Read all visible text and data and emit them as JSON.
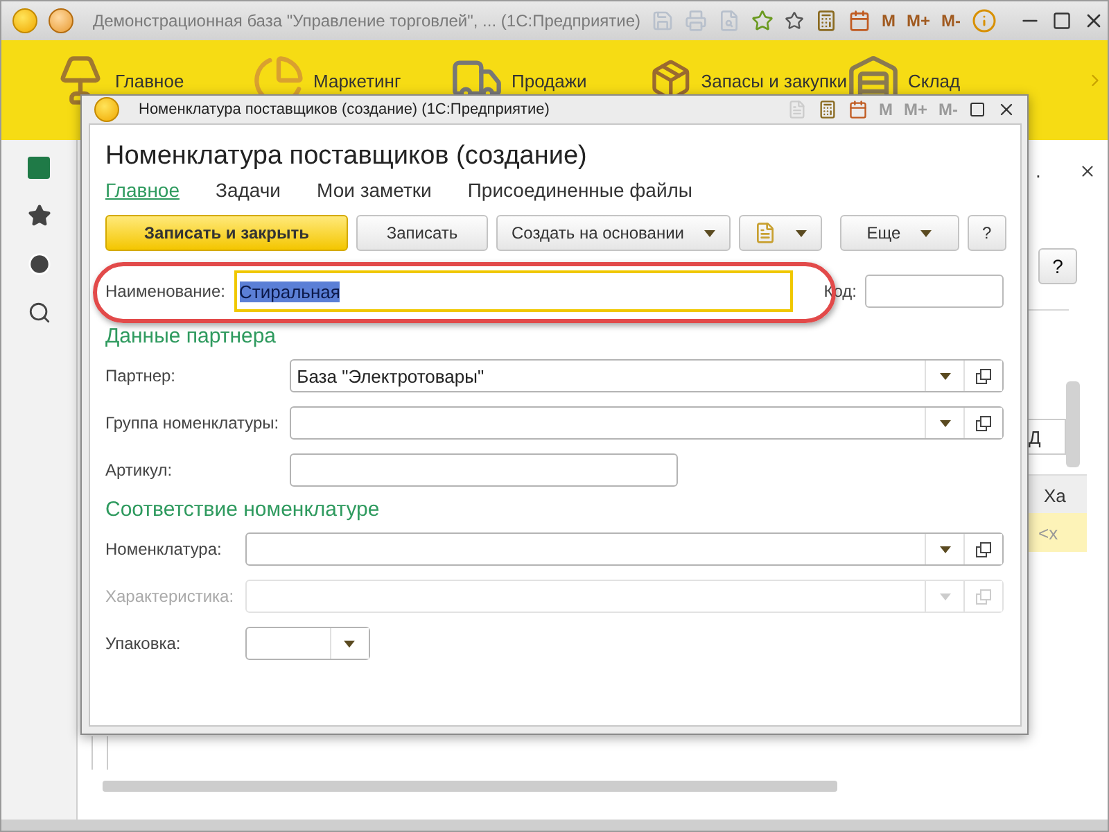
{
  "window": {
    "title": "Демонстрационная база \"Управление торговлей\", ... (1С:Предприятие)",
    "memory_buttons": [
      "M",
      "M+",
      "M-"
    ]
  },
  "sections": [
    {
      "label": "Главное",
      "kind": "lamp"
    },
    {
      "label": "Маркетинг",
      "kind": "pie"
    },
    {
      "label": "Продажи",
      "kind": "truck"
    },
    {
      "label": "Запасы и закупки",
      "kind": "boxes"
    },
    {
      "label": "Склад",
      "kind": "shelf"
    }
  ],
  "background_form": {
    "title_fragment": ".",
    "help_label": "?",
    "column_1": "Д",
    "column_2_header": "Ха",
    "row_1_cell": "<х"
  },
  "dialog": {
    "title": "Номенклатура поставщиков (создание)  (1С:Предприятие)",
    "memory_buttons": [
      "M",
      "M+",
      "M-"
    ],
    "memory_disabled": true,
    "heading": "Номенклатура поставщиков (создание)",
    "tabs": [
      {
        "label": "Главное",
        "selected": true
      },
      {
        "label": "Задачи",
        "selected": false
      },
      {
        "label": "Мои заметки",
        "selected": false
      },
      {
        "label": "Присоединенные файлы",
        "selected": false
      }
    ],
    "toolbar": [
      {
        "kind": "primary",
        "label": "Записать и закрыть"
      },
      {
        "kind": "button",
        "label": "Записать"
      },
      {
        "kind": "menu",
        "label": "Создать на основании"
      },
      {
        "kind": "icon_menu"
      },
      {
        "kind": "menu",
        "label": "Еще"
      },
      {
        "kind": "button",
        "label": "?"
      }
    ],
    "name_field": {
      "label": "Наименование:",
      "value": "Стиральная",
      "selected": true,
      "highlighted": true
    },
    "code_field": {
      "label": "Код:"
    },
    "groups": [
      {
        "title": "Данные партнера",
        "fields": [
          {
            "label": "Партнер:",
            "value": "База \"Электротовары\"",
            "kind": "choice",
            "disabled": false
          },
          {
            "label": "Группа номенклатуры:",
            "kind": "choice",
            "disabled": false
          },
          {
            "label": "Артикул:",
            "kind": "text",
            "disabled": false
          }
        ]
      },
      {
        "title": "Соответствие номенклатуре",
        "fields": [
          {
            "label": "Номенклатура:",
            "kind": "choice",
            "disabled": false
          },
          {
            "label": "Характеристика:",
            "kind": "choice",
            "disabled": true
          },
          {
            "label": "Упаковка:",
            "kind": "select",
            "disabled": false
          }
        ]
      }
    ]
  }
}
